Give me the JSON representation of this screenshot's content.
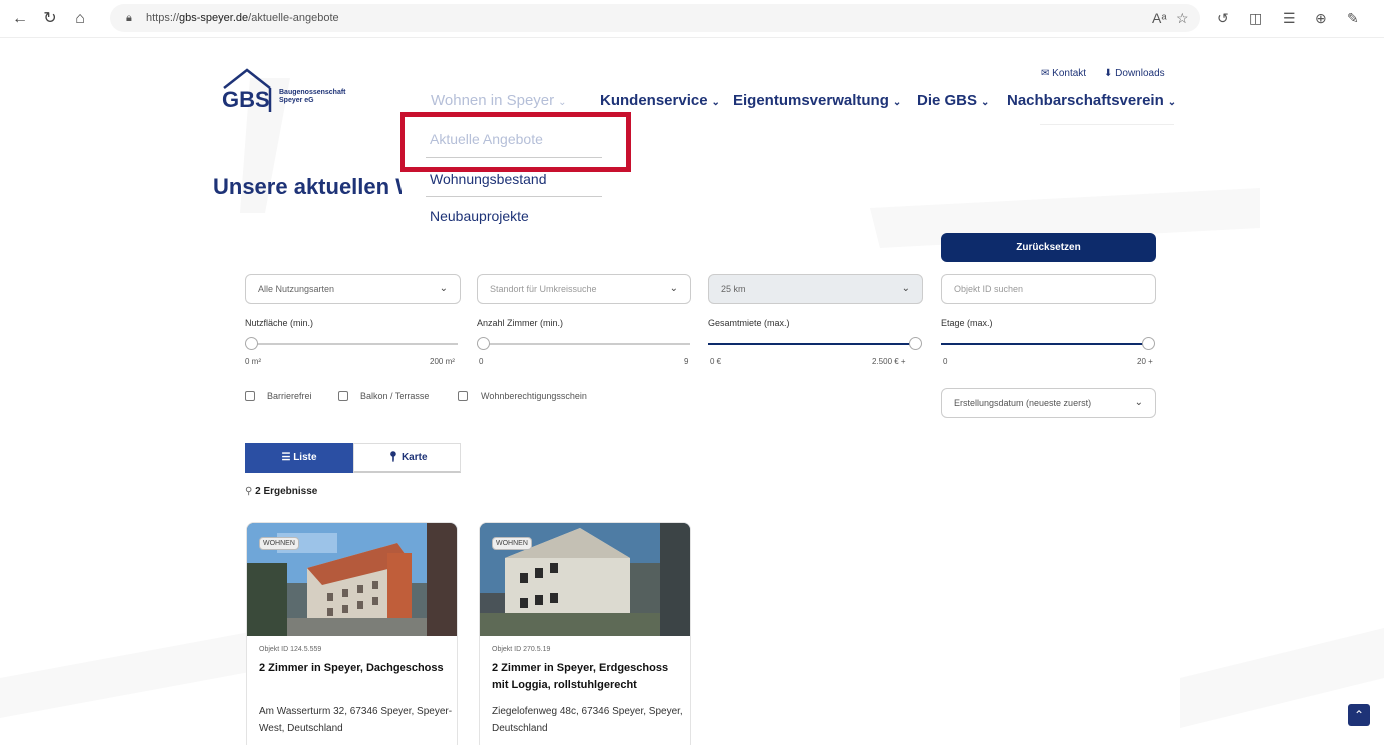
{
  "browser": {
    "url_prefix": "https://",
    "url_host": "gbs-speyer.de",
    "url_path": "/aktuelle-angebote"
  },
  "logo": {
    "mark": "GBS",
    "line1": "Baugenossenschaft",
    "line2": "Speyer eG"
  },
  "toplinks": {
    "contact": "Kontakt",
    "downloads": "Downloads"
  },
  "nav": [
    {
      "label": "Wohnen in Speyer"
    },
    {
      "label": "Kundenservice"
    },
    {
      "label": "Eigentumsverwaltung"
    },
    {
      "label": "Die GBS"
    },
    {
      "label": "Nachbarschaftsverein"
    }
  ],
  "dropdown": [
    {
      "label": "Aktuelle Angebote"
    },
    {
      "label": "Wohnungsbestand"
    },
    {
      "label": "Neubauprojekte"
    }
  ],
  "heading": "Unsere aktuellen Wo",
  "filters": {
    "reset_label": "Zurücksetzen",
    "usage": "Alle Nutzungsarten",
    "location_placeholder": "Standort für Umkreissuche",
    "radius": "25 km",
    "object_id_placeholder": "Objekt ID suchen",
    "area": {
      "label": "Nutzfläche (min.)",
      "min": "0 m²",
      "max": "200 m²",
      "value": 0
    },
    "rooms": {
      "label": "Anzahl Zimmer (min.)",
      "min": "0",
      "max": "9",
      "value": 0
    },
    "rent": {
      "label": "Gesamtmiete (max.)",
      "min": "0 €",
      "max": "2.500 € +",
      "value": 1.0
    },
    "floor": {
      "label": "Etage (max.)",
      "min": "0",
      "max": "20 +",
      "value": 1.0
    },
    "checkboxes": [
      "Barrierefrei",
      "Balkon / Terrasse",
      "Wohnberechtigungsschein"
    ],
    "sort": "Erstellungsdatum (neueste zuerst)"
  },
  "view_tabs": {
    "list": "Liste",
    "map": "Karte"
  },
  "results_count": "2 Ergebnisse",
  "listings": [
    {
      "badge": "WOHNEN",
      "object_id": "Objekt ID 124.5.559",
      "title": "2 Zimmer in Speyer, Dachgeschoss",
      "address": "Am Wasserturm 32, 67346 Speyer, Speyer-West, Deutschland"
    },
    {
      "badge": "WOHNEN",
      "object_id": "Objekt ID 270.5.19",
      "title": "2 Zimmer in Speyer, Erdgeschoss mit Loggia, rollstuhlgerecht",
      "address": "Ziegelofenweg 48c, 67346 Speyer, Speyer, Deutschland"
    }
  ],
  "colors": {
    "brand": "#1e3377",
    "button": "#0d2b6b",
    "tab_active": "#2b4fa3",
    "highlight": "#c8102e"
  }
}
